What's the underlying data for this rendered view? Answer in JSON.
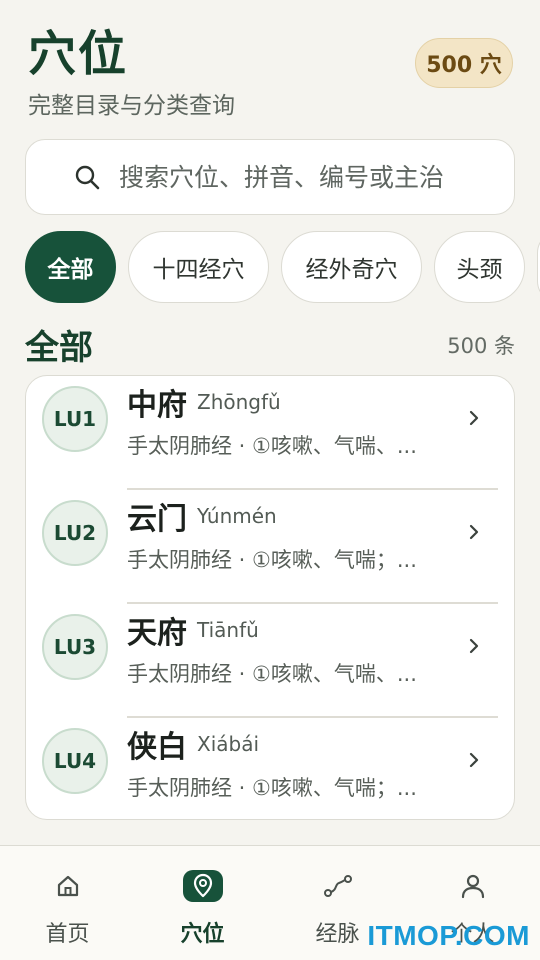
{
  "header": {
    "title": "穴位",
    "subtitle": "完整目录与分类查询",
    "count_badge": "500 穴"
  },
  "search": {
    "placeholder": "搜索穴位、拼音、编号或主治",
    "icon": "search-icon"
  },
  "filters": [
    {
      "label": "全部",
      "active": true
    },
    {
      "label": "十四经穴",
      "active": false
    },
    {
      "label": "经外奇穴",
      "active": false
    },
    {
      "label": "头颈",
      "active": false
    }
  ],
  "section": {
    "title": "全部",
    "count": "500 条"
  },
  "points": [
    {
      "code": "LU1",
      "name": "中府",
      "pinyin": "Zhōngfǔ",
      "desc": "手太阴肺经 · ①咳嗽、气喘、..."
    },
    {
      "code": "LU2",
      "name": "云门",
      "pinyin": "Yúnmén",
      "desc": "手太阴肺经 · ①咳嗽、气喘；..."
    },
    {
      "code": "LU3",
      "name": "天府",
      "pinyin": "Tiānfǔ",
      "desc": "手太阴肺经 · ①咳嗽、气喘、..."
    },
    {
      "code": "LU4",
      "name": "侠白",
      "pinyin": "Xiábái",
      "desc": "手太阴肺经 · ①咳嗽、气喘；..."
    }
  ],
  "tabs": [
    {
      "label": "首页",
      "icon": "home-icon",
      "active": false
    },
    {
      "label": "穴位",
      "icon": "location-pin-icon",
      "active": true
    },
    {
      "label": "经脉",
      "icon": "route-icon",
      "active": false
    },
    {
      "label": "个人",
      "icon": "person-icon",
      "active": false
    }
  ],
  "watermark": "ITMOP.COM",
  "colors": {
    "primary": "#17523a",
    "background": "#f5f4ef",
    "badge_bg": "#f3e5c6",
    "badge_text": "#6b4a13"
  }
}
